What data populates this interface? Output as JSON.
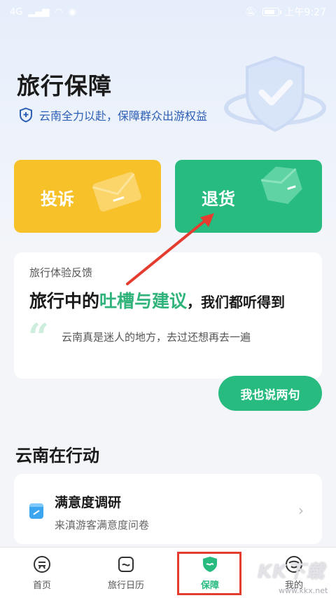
{
  "status_bar": {
    "left_text": "4G",
    "time": "上午9:27"
  },
  "header": {
    "title": "旅行保障",
    "subtitle": "云南全力以赴，保障群众出游权益"
  },
  "cards": {
    "complaint_label": "投诉",
    "return_label": "退货"
  },
  "feedback": {
    "small_label": "旅行体验反馈",
    "headline_prefix": "旅行中的",
    "headline_highlight": "吐槽与建议",
    "headline_suffix": "，我们都听得到",
    "quote_mark": "“",
    "quote": "云南真是迷人的地方，去过还想再去一遍",
    "button_label": "我也说两句"
  },
  "action_section": {
    "title": "云南在行动",
    "survey_title": "满意度调研",
    "survey_subtitle": "来滇游客满意度问卷",
    "chevron": "›"
  },
  "tabbar": {
    "items": [
      {
        "label": "首页",
        "icon": "home-icon"
      },
      {
        "label": "旅行日历",
        "icon": "calendar-icon"
      },
      {
        "label": "保障",
        "icon": "shield-icon",
        "active": true
      },
      {
        "label": "我的",
        "icon": "profile-icon"
      }
    ]
  },
  "watermark": {
    "text": "KK下载",
    "url": "www.kkx.net"
  },
  "colors": {
    "accent_green": "#27bb80",
    "complaint_yellow": "#f7c12a",
    "subtitle_blue": "#2d5fb5",
    "highlight_red": "#e43c2f"
  }
}
